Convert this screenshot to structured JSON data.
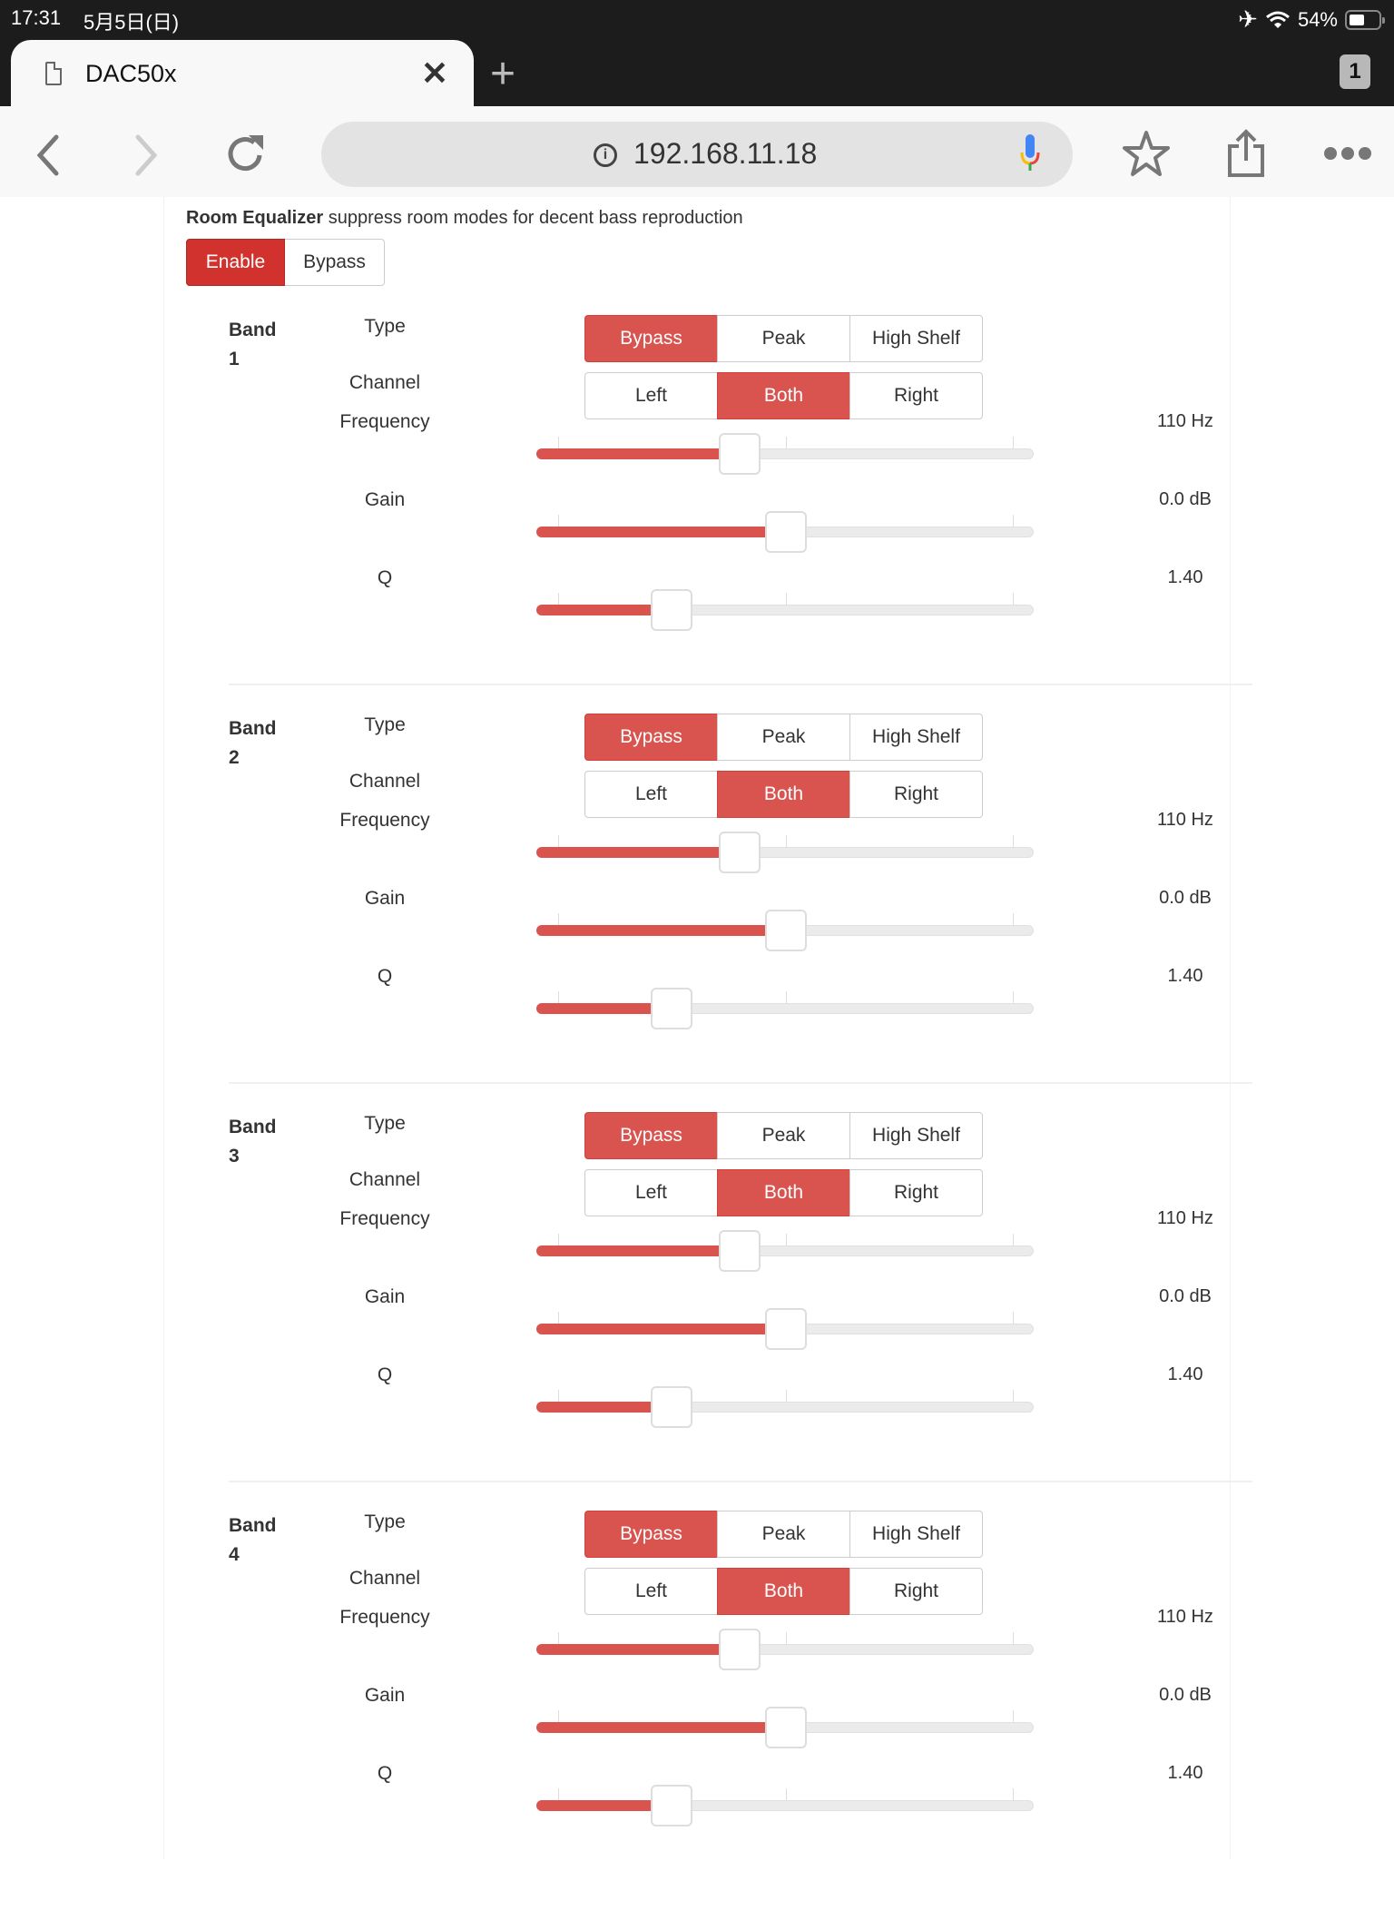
{
  "status_bar": {
    "time": "17:31",
    "date": "5月5日(日)",
    "battery_percent": "54%",
    "battery_level": 0.54
  },
  "browser": {
    "tab_title": "DAC50x",
    "tab_count": "1",
    "url": "192.168.11.18",
    "icons": {
      "back": "chevron-left-icon",
      "forward": "chevron-right-icon",
      "reload": "reload-icon",
      "bookmark": "star-icon",
      "share": "share-icon",
      "menu": "more-icon"
    }
  },
  "page": {
    "title_bold": "Room Equalizer",
    "title_rest": " suppress room modes for decent bass reproduction",
    "master_toggle": {
      "options": [
        "Enable",
        "Bypass"
      ],
      "selected": "Enable"
    },
    "labels": {
      "band": "Band",
      "type": "Type",
      "channel": "Channel",
      "frequency": "Frequency",
      "gain": "Gain",
      "q": "Q"
    },
    "type_options": [
      "Bypass",
      "Peak",
      "High Shelf"
    ],
    "channel_options": [
      "Left",
      "Both",
      "Right"
    ],
    "accent_color": "#d9534f",
    "bands": [
      {
        "number": "1",
        "type": "Bypass",
        "channel": "Both",
        "frequency": {
          "display": "110 Hz",
          "position": 0.4
        },
        "gain": {
          "display": "0.0 dB",
          "position": 0.5
        },
        "q": {
          "display": "1.40",
          "position": 0.25
        }
      },
      {
        "number": "2",
        "type": "Bypass",
        "channel": "Both",
        "frequency": {
          "display": "110 Hz",
          "position": 0.4
        },
        "gain": {
          "display": "0.0 dB",
          "position": 0.5
        },
        "q": {
          "display": "1.40",
          "position": 0.25
        }
      },
      {
        "number": "3",
        "type": "Bypass",
        "channel": "Both",
        "frequency": {
          "display": "110 Hz",
          "position": 0.4
        },
        "gain": {
          "display": "0.0 dB",
          "position": 0.5
        },
        "q": {
          "display": "1.40",
          "position": 0.25
        }
      },
      {
        "number": "4",
        "type": "Bypass",
        "channel": "Both",
        "frequency": {
          "display": "110 Hz",
          "position": 0.4
        },
        "gain": {
          "display": "0.0 dB",
          "position": 0.5
        },
        "q": {
          "display": "1.40",
          "position": 0.25
        }
      }
    ]
  }
}
